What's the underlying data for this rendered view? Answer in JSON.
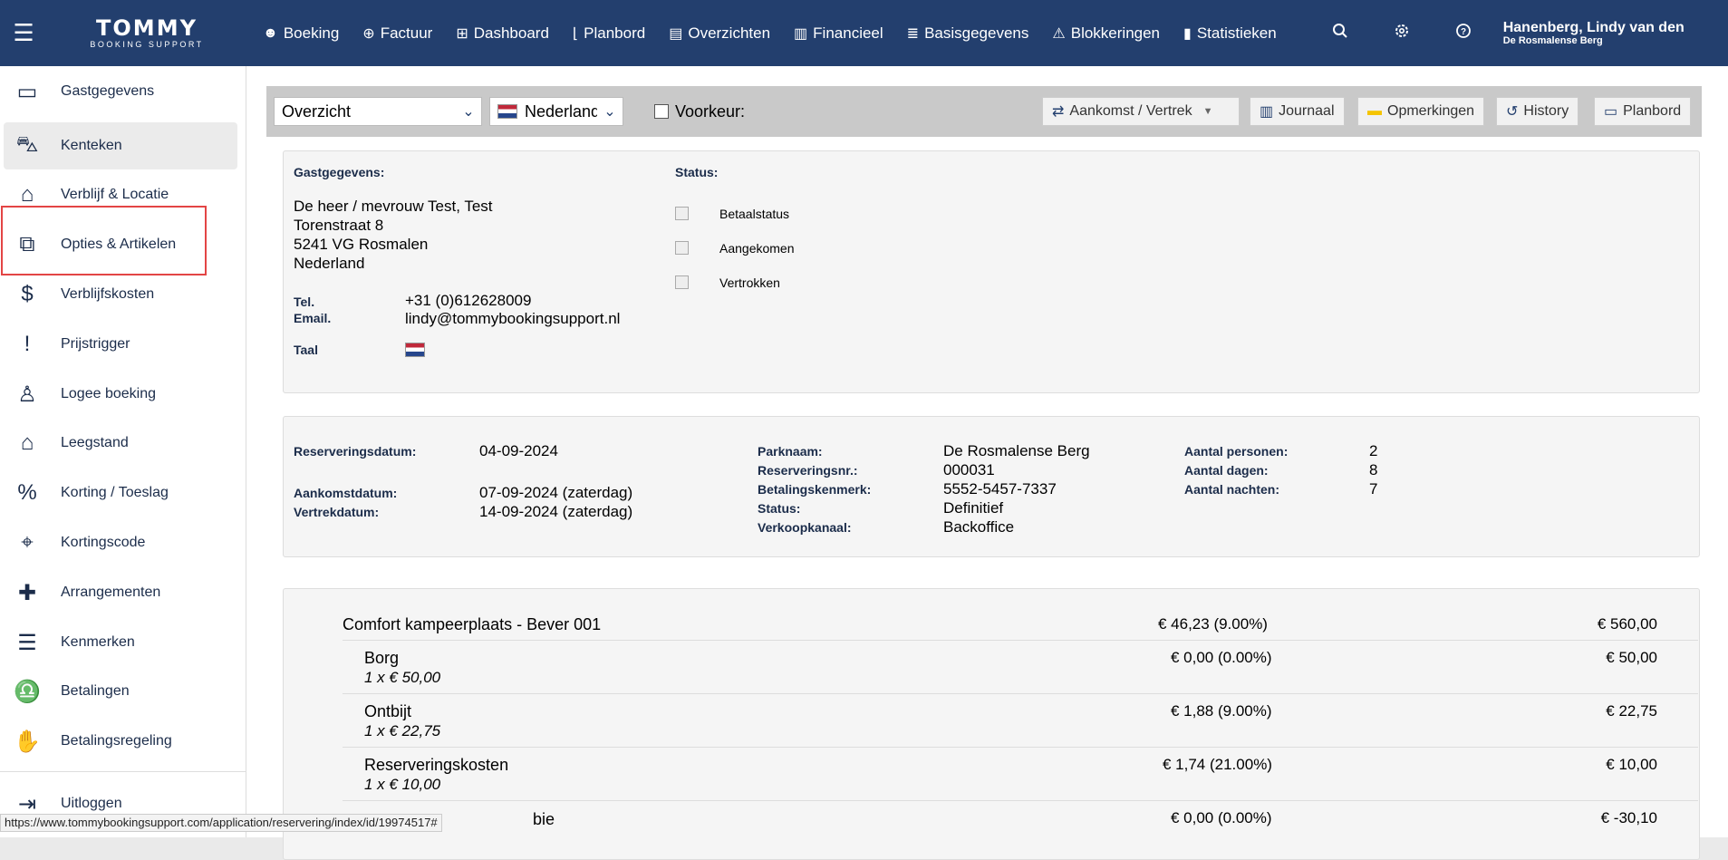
{
  "topbar": {
    "logo_main": "TOMMY",
    "logo_sub": "BOOKING SUPPORT",
    "nav": [
      {
        "icon": "smile-icon",
        "glyph": "☻",
        "label": "Boeking"
      },
      {
        "icon": "plus-circle-icon",
        "glyph": "⊕",
        "label": "Factuur"
      },
      {
        "icon": "grid-icon",
        "glyph": "⊞",
        "label": "Dashboard"
      },
      {
        "icon": "planbord-icon",
        "glyph": "⌊",
        "label": "Planbord"
      },
      {
        "icon": "list-icon",
        "glyph": "▤",
        "label": "Overzichten"
      },
      {
        "icon": "columns-icon",
        "glyph": "▥",
        "label": "Financieel"
      },
      {
        "icon": "database-icon",
        "glyph": "≣",
        "label": "Basisgegevens"
      },
      {
        "icon": "warning-icon",
        "glyph": "⚠",
        "label": "Blokkeringen"
      },
      {
        "icon": "bar-chart-icon",
        "glyph": "▮",
        "label": "Statistieken"
      }
    ],
    "user_name": "Hanenberg, Lindy van den",
    "user_park": "De Rosmalense Berg"
  },
  "sidebar": {
    "items": [
      {
        "icon": "id-card-icon",
        "glyph": "▭",
        "label": "Gastgegevens"
      },
      {
        "icon": "car-icon",
        "glyph": "⛍",
        "label": "Kenteken"
      },
      {
        "icon": "house-heart-icon",
        "glyph": "⌂",
        "label": "Verblijf & Locatie"
      },
      {
        "icon": "layers-plus-icon",
        "glyph": "⧉",
        "label": "Opties & Artikelen"
      },
      {
        "icon": "dollar-square-icon",
        "glyph": "$",
        "label": "Verblijfskosten"
      },
      {
        "icon": "exclamation-square-icon",
        "glyph": "!",
        "label": "Prijstrigger"
      },
      {
        "icon": "user-plus-icon",
        "glyph": "♙",
        "label": "Logee boeking"
      },
      {
        "icon": "house-run-icon",
        "glyph": "⌂",
        "label": "Leegstand"
      },
      {
        "icon": "percent-badge-icon",
        "glyph": "%",
        "label": "Korting / Toeslag"
      },
      {
        "icon": "tag-icon",
        "glyph": "⌖",
        "label": "Kortingscode"
      },
      {
        "icon": "gift-icon",
        "glyph": "✚",
        "label": "Arrangementen"
      },
      {
        "icon": "checklist-icon",
        "glyph": "☰",
        "label": "Kenmerken"
      },
      {
        "icon": "piggy-bank-icon",
        "glyph": "♎",
        "label": "Betalingen"
      },
      {
        "icon": "handshake-icon",
        "glyph": "✋",
        "label": "Betalingsregeling"
      }
    ],
    "logout": {
      "icon": "logout-icon",
      "glyph": "⇥",
      "label": "Uitloggen"
    }
  },
  "toolbar": {
    "view_select": "Overzicht",
    "language_select": "Nederlands",
    "voorkeur_label": "Voorkeur:",
    "buttons": [
      {
        "icon": "swap-icon",
        "glyph": "⇄",
        "label": "Aankomst / Vertrek",
        "caret": "▼"
      },
      {
        "icon": "journal-icon",
        "glyph": "▥",
        "label": "Journaal"
      },
      {
        "icon": "comment-icon",
        "glyph": "▬",
        "label": "Opmerkingen"
      },
      {
        "icon": "history-icon",
        "glyph": "↺",
        "label": "History"
      },
      {
        "icon": "planbord-window-icon",
        "glyph": "▭",
        "label": "Planbord"
      }
    ]
  },
  "guest": {
    "heading": "Gastgegevens:",
    "address_lines": [
      "De heer / mevrouw Test, Test",
      "Torenstraat 8",
      "5241 VG Rosmalen",
      "Nederland"
    ],
    "tel_label": "Tel.",
    "tel": "+31 (0)612628009",
    "email_label": "Email.",
    "email": "lindy@tommybookingsupport.nl",
    "taal_label": "Taal"
  },
  "status": {
    "heading": "Status:",
    "items": [
      "Betaalstatus",
      "Aangekomen",
      "Vertrokken"
    ]
  },
  "reservation": {
    "reserveringsdatum_label": "Reserveringsdatum:",
    "reserveringsdatum": "04-09-2024",
    "aankomst_label": "Aankomstdatum:",
    "aankomst": "07-09-2024 (zaterdag)",
    "vertrek_label": "Vertrekdatum:",
    "vertrek": "14-09-2024 (zaterdag)",
    "parknaam_label": "Parknaam:",
    "parknaam": "De Rosmalense Berg",
    "resnr_label": "Reserveringsnr.:",
    "resnr": "000031",
    "kenmerk_label": "Betalingskenmerk:",
    "kenmerk": "5552-5457-7337",
    "status_label": "Status:",
    "status": "Definitief",
    "kanaal_label": "Verkoopkanaal:",
    "kanaal": "Backoffice",
    "personen_label": "Aantal personen:",
    "personen": "2",
    "dagen_label": "Aantal dagen:",
    "dagen": "8",
    "nachten_label": "Aantal nachten:",
    "nachten": "7"
  },
  "lines": {
    "main": {
      "name": "Comfort kampeerplaats - Bever 001",
      "tax": "€ 46,23 (9.00%)",
      "amount": "€ 560,00"
    },
    "items": [
      {
        "name": "Borg",
        "qty": "1 x € 50,00",
        "tax": "€ 0,00 (0.00%)",
        "amount": "€ 50,00"
      },
      {
        "name": "Ontbijt",
        "qty": "1 x € 22,75",
        "tax": "€ 1,88 (9.00%)",
        "amount": "€ 22,75"
      },
      {
        "name": "Reserveringskosten",
        "qty": "1 x € 10,00",
        "tax": "€ 1,74 (21.00%)",
        "amount": "€ 10,00"
      },
      {
        "name": "bie",
        "tax": "€ 0,00 (0.00%)",
        "amount": "€ -30,10"
      }
    ]
  },
  "statusbar": {
    "url": "https://www.tommybookingsupport.com/application/reservering/index/id/19974517#"
  }
}
